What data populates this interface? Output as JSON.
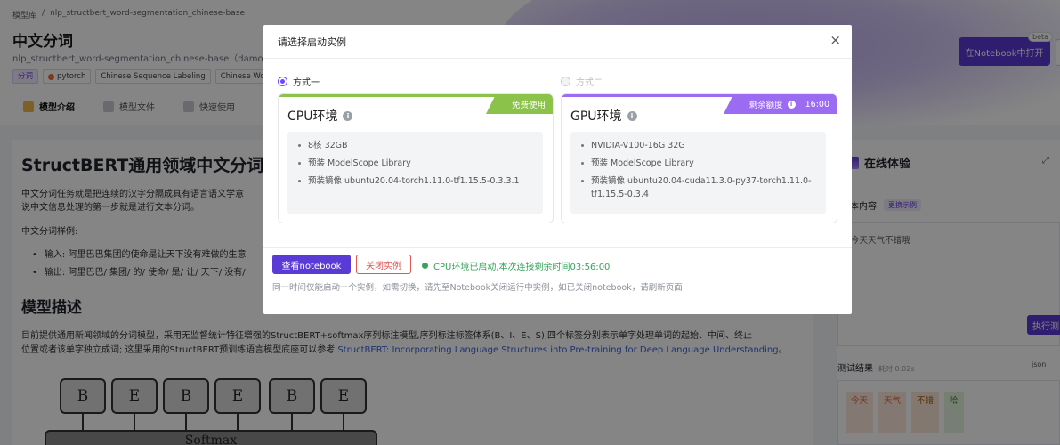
{
  "header": {
    "breadcrumb": [
      "模型库",
      "/",
      "nlp_structbert_word-segmentation_chinese-base"
    ],
    "title": "中文分词",
    "subtitle": "nlp_structbert_word-segmentation_chinese-base（damo 提供",
    "tags": [
      "分词",
      "pytorch",
      "Chinese Sequence Labeling",
      "Chinese Word"
    ],
    "tabs": [
      "模型介绍",
      "模型文件",
      "快速使用"
    ],
    "notebook_button": "在Notebook中打开",
    "beta_label": "beta"
  },
  "main": {
    "heading": "StructBERT通用领域中文分词模",
    "intro": "中文分词任务就是把连续的汉字分隔成具有语言语义学意",
    "intro2": "说中文信息处理的第一步就是进行文本分词。",
    "example_label": "中文分词样例:",
    "example_input": "输入: 阿里巴巴集团的使命是让天下没有难做的生意",
    "example_output": "输出: 阿里巴巴/ 集团/ 的/ 使命/ 是/ 让/ 天下/ 没有/",
    "section_title": "模型描述",
    "desc1": "目前提供通用新闻领域的分词模型，采用无监督统计特征增强的StructBERT+softmax序列标注模型,序列标注标签体系(B、I、E、S),四个标签分别表示单字处理单词的起始、中间、终止",
    "desc2_prefix": "位置或者该单字独立成词; 这里采用的StructBERT预训练语言模型底座可以参考 ",
    "desc2_link": "StructBERT: Incorporating Language Structures into Pre-training for Deep Language Understanding",
    "desc2_suffix": "。",
    "diagram_labels": [
      "B",
      "E",
      "B",
      "E",
      "B",
      "E"
    ],
    "diagram_layer": "Softmax"
  },
  "right_panel": {
    "title": "在线体验",
    "input_label": "本内容",
    "change_example": "更换示例",
    "input_text": "今天天气不错哦",
    "run_button": "执行测",
    "result_label": "测试结果",
    "result_time": "耗时 0.02s",
    "json_label": "json",
    "result_chips": [
      "今天",
      "天气",
      "不错",
      "哈"
    ]
  },
  "modal": {
    "title": "请选择启动实例",
    "options": [
      "方式一",
      "方式二"
    ],
    "cpu": {
      "title": "CPU环境",
      "badge": "免费使用",
      "specs": [
        "8核 32GB",
        "预装 ModelScope Library",
        "预装镜像 ubuntu20.04-torch1.11.0-tf1.15.5-0.3.3.1"
      ]
    },
    "gpu": {
      "title": "GPU环境",
      "badge": "剩余额度",
      "badge_time": "16:00",
      "specs": [
        "NVIDIA-V100-16G 32G",
        "预装 ModelScope Library",
        "预装镜像 ubuntu20.04-cuda11.3.0-py37-torch1.11.0-tf1.15.5-0.3.4"
      ]
    },
    "view_button": "查看notebook",
    "close_button": "关闭实例",
    "status": "CPU环境已启动,本次连接剩余时间03:56:00",
    "note": "同一时间仅能启动一个实例，如需切换，请先至Notebook关闭运行中实例，如已关闭notebook，请刷新页面"
  },
  "colors": {
    "primary": "#5b3bd6",
    "cpu_badge": "#8bc34a",
    "gpu_badge": "#9b6bf2",
    "status_green": "#35a45a",
    "danger": "#e25555"
  }
}
